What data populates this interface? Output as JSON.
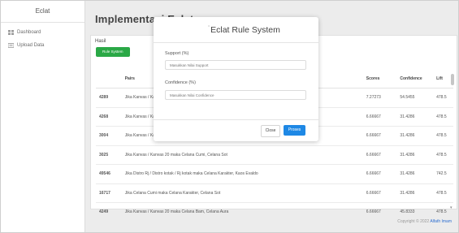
{
  "sidebar": {
    "brand": "Eclat",
    "items": [
      {
        "label": "Dashboard",
        "icon": "dashboard-icon"
      },
      {
        "label": "Upload Data",
        "icon": "upload-icon"
      }
    ]
  },
  "page": {
    "title": "Implementasi Eclat"
  },
  "card": {
    "label": "Hasil",
    "rule_button": "Rule System"
  },
  "table": {
    "headers": [
      "",
      "Pairs",
      "Scores",
      "Confidence",
      "Lift"
    ],
    "rows": [
      {
        "id": "4289",
        "pair": "Jika Kanvas / Kanvas 20 maka Celana Cumi, Celana Sot",
        "score": "7.27273",
        "conf": "54.5455",
        "lift": "478.5"
      },
      {
        "id": "4268",
        "pair": "Jika Kanvas / Kanvas 20 maka Celana Cumi, Celana Sot",
        "score": "6.66667",
        "conf": "31.4286",
        "lift": "478.5"
      },
      {
        "id": "3004",
        "pair": "Jika Kanvas / Kanvas 20 maka Celana Cumi, Celana Sot",
        "score": "6.66667",
        "conf": "31.4286",
        "lift": "478.5"
      },
      {
        "id": "3025",
        "pair": "Jika Kanvas / Kanvas 20 maka Celana Cumi, Celana Sot",
        "score": "6.66667",
        "conf": "31.4286",
        "lift": "478.5"
      },
      {
        "id": "49546",
        "pair": "Jika Distro Rj / Distro kotak / Rj kotak maka Celana Karakter, Kaos Evaldo",
        "score": "6.66667",
        "conf": "31.4286",
        "lift": "742.5"
      },
      {
        "id": "16717",
        "pair": "Jika Celana Cumi maka Celana Karakter, Celana Sot",
        "score": "6.66667",
        "conf": "31.4286",
        "lift": "478.5"
      },
      {
        "id": "4249",
        "pair": "Jika Kanvas / Kanvas 20 maka Celana Bam, Celana Aura",
        "score": "6.66667",
        "conf": "45.8333",
        "lift": "478.5"
      }
    ]
  },
  "footer": {
    "prefix": "Copyright © 2022",
    "author": "Alfath Imam"
  },
  "modal": {
    "title": "Eclat Rule System",
    "support_label": "Support (%)",
    "support_placeholder": "Masukkan Nilai Support",
    "confidence_label": "Confidence (%)",
    "confidence_placeholder": "Masukkan Nilai Confidence",
    "close_label": "Close",
    "submit_label": "Proses"
  },
  "colors": {
    "primary": "#1e88e5",
    "success": "#2aa846",
    "link": "#2f6fd1"
  }
}
